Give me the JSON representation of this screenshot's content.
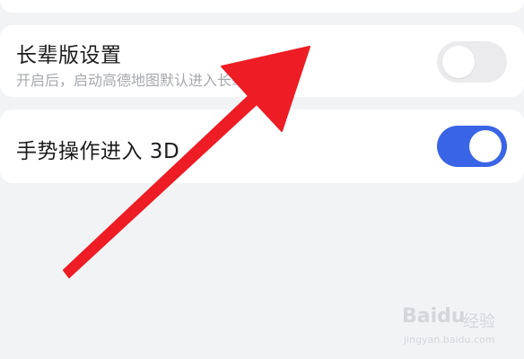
{
  "settings": {
    "senior_mode": {
      "title": "长辈版设置",
      "description": "开启后，启动高德地图默认进入长辈版",
      "enabled": false
    },
    "gesture_3d": {
      "title": "手势操作进入 3D",
      "enabled": true
    }
  },
  "overlay": {
    "arrow_color": "#ee1c24"
  },
  "watermark": {
    "logo": "Baidu",
    "sub": "经验",
    "url": "jingyan.baidu.com"
  },
  "colors": {
    "toggle_on": "#3a64e6",
    "toggle_off": "#ebebee",
    "background": "#f2f3f5"
  }
}
